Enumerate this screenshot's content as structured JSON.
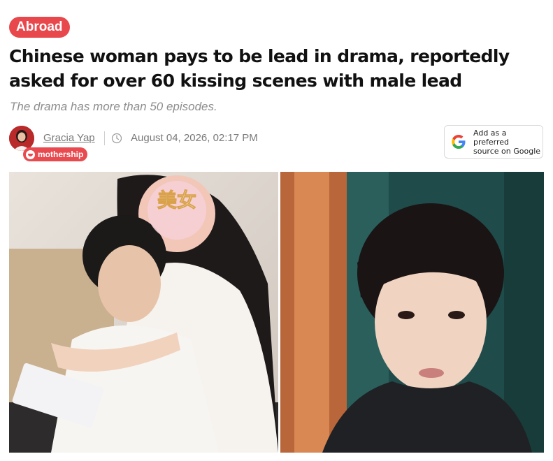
{
  "article": {
    "category": "Abroad",
    "headline": "Chinese woman pays to be lead in drama, reportedly asked for over 60 kissing scenes with male lead",
    "subtitle": "The drama has more than 50 episodes."
  },
  "byline": {
    "author": "Gracia Yap",
    "timestamp": "August 04, 2026, 02:17 PM",
    "brand_badge": "mothership",
    "icons": {
      "clock": "clock-icon",
      "avatar": "author-avatar"
    }
  },
  "google_button": {
    "line1": "Add as a preferred",
    "line2": "source on Google",
    "icon": "google-g-icon"
  },
  "images": {
    "left_sticker_text": "美女"
  },
  "colors": {
    "accent": "#e8474c",
    "muted_text": "#8d8d8d"
  }
}
